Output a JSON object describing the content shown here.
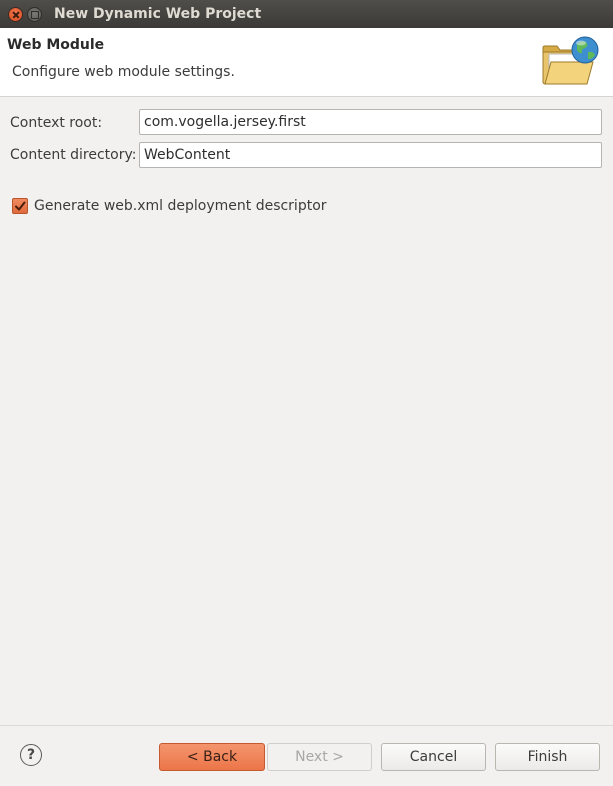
{
  "window": {
    "title": "New Dynamic Web Project"
  },
  "header": {
    "title": "Web Module",
    "description": "Configure web module settings.",
    "icon": "web-folder-globe-icon"
  },
  "form": {
    "context_root": {
      "label": "Context root:",
      "value": "com.vogella.jersey.first"
    },
    "content_directory": {
      "label": "Content directory:",
      "value": "WebContent"
    },
    "generate_descriptor": {
      "label": "Generate web.xml deployment descriptor",
      "checked": true
    }
  },
  "footer": {
    "help_icon": "?",
    "back_label": "< Back",
    "next_label": "Next >",
    "cancel_label": "Cancel",
    "finish_label": "Finish"
  },
  "colors": {
    "accent": "#ec7548",
    "titlebar": "#3b3a36",
    "background": "#f2f1f0"
  }
}
